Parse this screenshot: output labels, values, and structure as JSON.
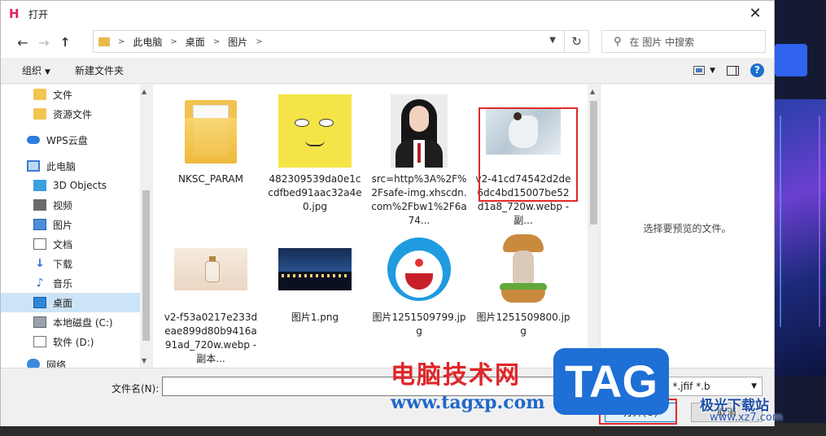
{
  "dialog": {
    "title": "打开",
    "close": "✕"
  },
  "nav": {
    "back": "←",
    "forward": "→",
    "up": "↑",
    "breadcrumb": [
      "此电脑",
      "桌面",
      "图片"
    ],
    "refresh": "↻",
    "search_placeholder": "在 图片 中搜索"
  },
  "toolbar": {
    "organize": "组织",
    "new_folder": "新建文件夹",
    "help": "?"
  },
  "sidebar": {
    "items": [
      {
        "label": "文件",
        "icon": "folder-icon"
      },
      {
        "label": "资源文件",
        "icon": "folder-icon"
      },
      {
        "label": "WPS云盘",
        "icon": "cloud-icon"
      },
      {
        "label": "此电脑",
        "icon": "computer-icon"
      },
      {
        "label": "3D Objects",
        "icon": "cube-icon"
      },
      {
        "label": "视频",
        "icon": "video-icon"
      },
      {
        "label": "图片",
        "icon": "picture-icon"
      },
      {
        "label": "文档",
        "icon": "document-icon"
      },
      {
        "label": "下载",
        "icon": "download-icon"
      },
      {
        "label": "音乐",
        "icon": "music-icon"
      },
      {
        "label": "桌面",
        "icon": "desktop-icon",
        "selected": true
      },
      {
        "label": "本地磁盘 (C:)",
        "icon": "drive-icon"
      },
      {
        "label": "软件 (D:)",
        "icon": "drive-icon"
      },
      {
        "label": "网络",
        "icon": "network-icon"
      }
    ]
  },
  "files": [
    {
      "name": "NKSC_PARAM"
    },
    {
      "name": "482309539da0e1ccdfbed91aac32a4e0.jpg"
    },
    {
      "name": "src=http%3A%2F%2Fsafe-img.xhscdn.com%2Fbw1%2F6a74..."
    },
    {
      "name": "v2-41cd74542d2de6dc4bd15007be52d1a8_720w.webp - 副...",
      "highlighted": true
    },
    {
      "name": "v2-f53a0217e233deae899d80b9416a91ad_720w.webp - 副本..."
    },
    {
      "name": "图片1.png"
    },
    {
      "name": "图片1251509799.jpg"
    },
    {
      "name": "图片1251509800.jpg"
    }
  ],
  "preview": {
    "message": "选择要预览的文件。"
  },
  "bottom": {
    "filename_label": "文件名(N):",
    "filename_value": "",
    "filetype": "(*.jpg *.jpeg *.jfif *.b",
    "open": "打开(O)",
    "cancel": "取消"
  },
  "watermarks": {
    "cn": "电脑技术网",
    "url": "www.tagxp.com",
    "tag": "TAG",
    "site": "极光下载站",
    "site_url": "www.xz7.com"
  },
  "colors": {
    "highlight_border": "#e02a2a",
    "selection": "#cce4f7",
    "accent": "#0078d7"
  }
}
